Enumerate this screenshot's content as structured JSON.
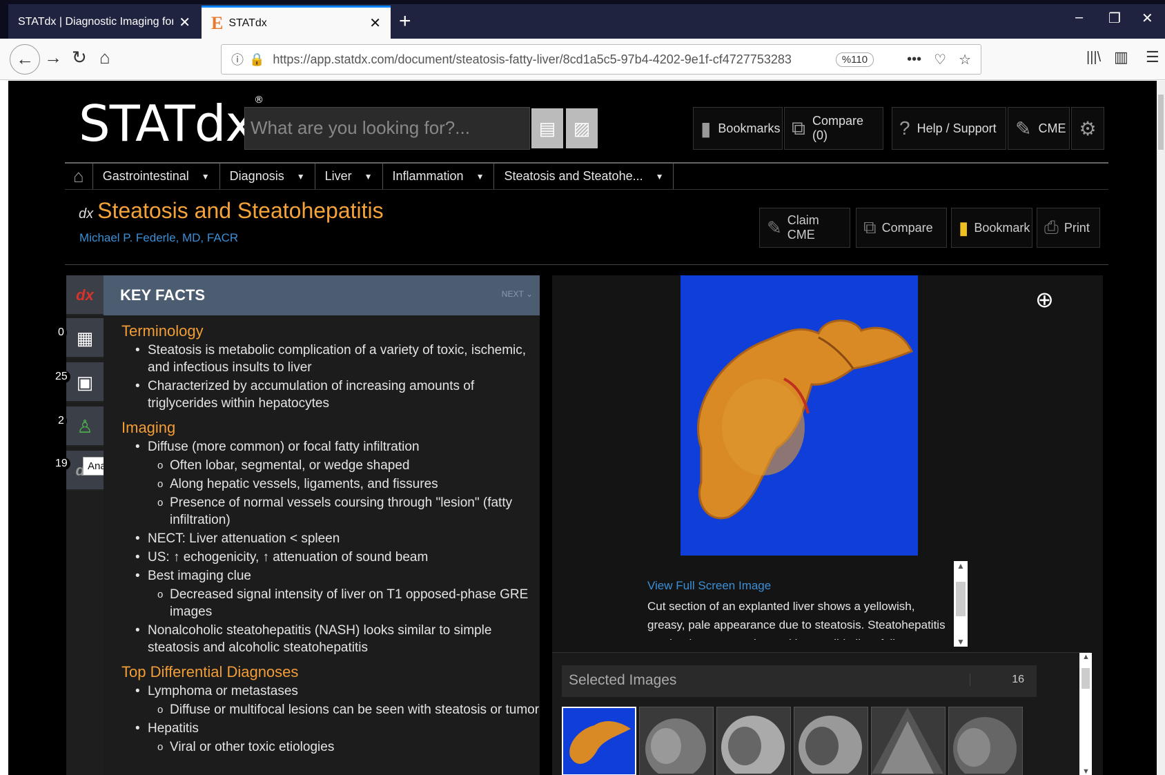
{
  "browser": {
    "tabs": [
      {
        "title": "STATdx | Diagnostic Imaging for Ra",
        "close": "✕"
      },
      {
        "title": "STATdx",
        "close": "✕",
        "favicon": "E"
      }
    ],
    "new_tab": "+",
    "window_controls": {
      "minimize": "–",
      "restore": "❐",
      "close": "✕"
    },
    "nav": {
      "back": "←",
      "forward": "→",
      "reload": "↻",
      "home": "⌂"
    },
    "url": "https://app.statdx.com/document/steatosis-fatty-liver/8cd1a5c5-97b4-4202-9e1f-cf4727753283",
    "zoom": "%110",
    "page_actions": {
      "more": "•••",
      "pocket": "♡",
      "star": "☆"
    },
    "toolbar_right": {
      "library": "|||\\",
      "sidebar": "▥",
      "menu": "☰"
    }
  },
  "header": {
    "logo": "STATdx",
    "logo_mark": "®",
    "search_placeholder": "What are you looking for?...",
    "buttons": {
      "bookmarks": "Bookmarks",
      "compare": "Compare (0)",
      "help": "Help / Support",
      "cme": "CME"
    }
  },
  "breadcrumbs": [
    "Gastrointestinal",
    "Diagnosis",
    "Liver",
    "Inflammation",
    "Steatosis and Steatohe..."
  ],
  "document": {
    "title_mark": "dx",
    "title": "Steatosis and Steatohepatitis",
    "author": "Michael P. Federle, MD, FACR",
    "actions": {
      "claim_cme": "Claim CME",
      "compare": "Compare",
      "bookmark": "Bookmark",
      "print": "Print"
    }
  },
  "rail": {
    "counts": [
      "0",
      "25",
      "2",
      "19"
    ],
    "tooltip": "Anatomy"
  },
  "key_facts": {
    "heading": "KEY FACTS",
    "next": "NEXT",
    "sections": [
      {
        "title": "Terminology",
        "items": [
          {
            "text": "Steatosis is metabolic complication of a variety of toxic, ischemic, and infectious insults to liver",
            "sub": []
          },
          {
            "text": "Characterized by accumulation of increasing amounts of triglycerides within hepatocytes",
            "sub": []
          }
        ]
      },
      {
        "title": "Imaging",
        "items": [
          {
            "text": "Diffuse (more common) or focal fatty infiltration",
            "sub": [
              "Often lobar, segmental, or wedge shaped",
              "Along hepatic vessels, ligaments, and fissures",
              "Presence of normal vessels coursing through \"lesion\" (fatty infiltration)"
            ]
          },
          {
            "text": "NECT: Liver attenuation < spleen",
            "sub": []
          },
          {
            "text": "US: ↑ echogenicity, ↑ attenuation of sound beam",
            "sub": []
          },
          {
            "text": "Best imaging clue",
            "sub": [
              "Decreased signal intensity of liver on T1 opposed-phase GRE images"
            ]
          },
          {
            "text": "Nonalcoholic steatohepatitis (NASH) looks similar to simple steatosis and alcoholic steatohepatitis",
            "sub": []
          }
        ]
      },
      {
        "title": "Top Differential Diagnoses",
        "items": [
          {
            "text": "Lymphoma or metastases",
            "sub": [
              "Diffuse or multifocal lesions can be seen with steatosis or tumor"
            ]
          },
          {
            "text": "Hepatitis",
            "sub": [
              "Viral or other toxic etiologies"
            ]
          }
        ]
      }
    ]
  },
  "image_panel": {
    "view_full_screen": "View Full Screen Image",
    "caption": "Cut section of an explanted liver shows a yellowish, greasy, pale appearance due to steatosis. Steatohepatitis can lead to progressive and irreversible liver failure.",
    "selected_label": "Selected Images",
    "selected_count": "16",
    "accent_background": "#0f3fd8"
  },
  "colors": {
    "section_heading": "#f29d36",
    "link": "#3b8fd7",
    "title": "#f4a23a",
    "header_bar": "#4d5d71"
  }
}
